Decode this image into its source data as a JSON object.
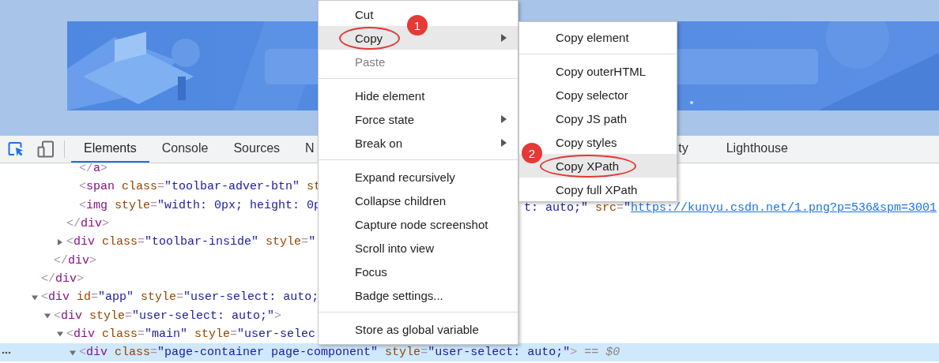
{
  "devtools": {
    "tabs": [
      {
        "label": "Elements",
        "kind": "tab",
        "selected": true
      },
      {
        "label": "Console",
        "kind": "tab",
        "selected": false
      },
      {
        "label": "Sources",
        "kind": "tab",
        "selected": false
      },
      {
        "label": "N",
        "kind": "clipped_end",
        "selected": false
      },
      {
        "label": "ty",
        "kind": "clipped_start",
        "selected": false
      },
      {
        "label": "Lighthouse",
        "kind": "tab",
        "selected": false
      }
    ],
    "dom_tree": [
      {
        "children": [
          {
            "children": [
              {
                "children": [
                  {
                    "selected": false,
                    "tokens": [
                      {
                        "kind": "punct",
                        "text": "</"
                      },
                      {
                        "kind": "tag",
                        "text": "a"
                      },
                      {
                        "kind": "punct",
                        "text": ">"
                      }
                    ]
                  },
                  {
                    "selected": false,
                    "tokens": [
                      {
                        "kind": "punct",
                        "text": "<"
                      },
                      {
                        "kind": "tag",
                        "text": "span"
                      },
                      {
                        "kind": "attr",
                        "text": " class"
                      },
                      {
                        "kind": "punct",
                        "text": "="
                      },
                      {
                        "kind": "value",
                        "text": "\"toolbar-adver-btn\""
                      },
                      {
                        "kind": "attr",
                        "text": " st"
                      }
                    ]
                  },
                  {
                    "selected": false,
                    "tokens": [
                      {
                        "kind": "punct",
                        "text": "<"
                      },
                      {
                        "kind": "tag",
                        "text": "img"
                      },
                      {
                        "kind": "attr",
                        "text": " style"
                      },
                      {
                        "kind": "punct",
                        "text": "="
                      },
                      {
                        "kind": "value",
                        "text": "\"width: 0px; height: 0p"
                      }
                    ],
                    "tail": {
                      "tokens": [
                        {
                          "kind": "value",
                          "text": "t: auto;\""
                        },
                        {
                          "kind": "attr",
                          "text": " src"
                        },
                        {
                          "kind": "punct",
                          "text": "="
                        },
                        {
                          "kind": "value",
                          "text": "\""
                        }
                      ],
                      "link": "https://kunyu.csdn.net/1.png?p=536&spm=3001"
                    }
                  }
                ]
              },
              {
                "selected": false,
                "tokens": [
                  {
                    "kind": "punct",
                    "text": "</"
                  },
                  {
                    "kind": "tag",
                    "text": "div"
                  },
                  {
                    "kind": "punct",
                    "text": ">"
                  }
                ]
              },
              {
                "selected": false,
                "expanded": false,
                "tokens": [
                  {
                    "kind": "punct",
                    "text": "<"
                  },
                  {
                    "kind": "tag",
                    "text": "div"
                  },
                  {
                    "kind": "attr",
                    "text": " class"
                  },
                  {
                    "kind": "punct",
                    "text": "="
                  },
                  {
                    "kind": "value",
                    "text": "\"toolbar-inside\""
                  },
                  {
                    "kind": "attr",
                    "text": " style"
                  },
                  {
                    "kind": "punct",
                    "text": "="
                  },
                  {
                    "kind": "value",
                    "text": "\""
                  }
                ]
              }
            ]
          },
          {
            "selected": false,
            "tokens": [
              {
                "kind": "punct",
                "text": "</"
              },
              {
                "kind": "tag",
                "text": "div"
              },
              {
                "kind": "punct",
                "text": ">"
              }
            ]
          }
        ]
      },
      {
        "selected": false,
        "tokens": [
          {
            "kind": "punct",
            "text": "</"
          },
          {
            "kind": "tag",
            "text": "div"
          },
          {
            "kind": "punct",
            "text": ">"
          }
        ]
      },
      {
        "selected": false,
        "expanded": true,
        "tokens": [
          {
            "kind": "punct",
            "text": "<"
          },
          {
            "kind": "tag",
            "text": "div"
          },
          {
            "kind": "attr",
            "text": " id"
          },
          {
            "kind": "punct",
            "text": "="
          },
          {
            "kind": "value",
            "text": "\"app\""
          },
          {
            "kind": "attr",
            "text": " style"
          },
          {
            "kind": "punct",
            "text": "="
          },
          {
            "kind": "value",
            "text": "\"user-select: auto;"
          }
        ],
        "children": [
          {
            "selected": false,
            "expanded": true,
            "tokens": [
              {
                "kind": "punct",
                "text": "<"
              },
              {
                "kind": "tag",
                "text": "div"
              },
              {
                "kind": "attr",
                "text": " style"
              },
              {
                "kind": "punct",
                "text": "="
              },
              {
                "kind": "value",
                "text": "\"user-select: auto;\""
              },
              {
                "kind": "punct",
                "text": ">"
              }
            ],
            "children": [
              {
                "selected": false,
                "expanded": true,
                "tokens": [
                  {
                    "kind": "punct",
                    "text": "<"
                  },
                  {
                    "kind": "tag",
                    "text": "div"
                  },
                  {
                    "kind": "attr",
                    "text": " class"
                  },
                  {
                    "kind": "punct",
                    "text": "="
                  },
                  {
                    "kind": "value",
                    "text": "\"main\""
                  },
                  {
                    "kind": "attr",
                    "text": " style"
                  },
                  {
                    "kind": "punct",
                    "text": "="
                  },
                  {
                    "kind": "value",
                    "text": "\"user-selec"
                  }
                ],
                "children": [
                  {
                    "selected": true,
                    "expanded": true,
                    "tokens": [
                      {
                        "kind": "punct",
                        "text": "<"
                      },
                      {
                        "kind": "tag",
                        "text": "div"
                      },
                      {
                        "kind": "attr",
                        "text": " class"
                      },
                      {
                        "kind": "punct",
                        "text": "="
                      },
                      {
                        "kind": "value",
                        "text": "\"page-container page-component\""
                      },
                      {
                        "kind": "attr",
                        "text": " style"
                      },
                      {
                        "kind": "punct",
                        "text": "="
                      },
                      {
                        "kind": "value",
                        "text": "\"user-select: auto;\""
                      },
                      {
                        "kind": "punct",
                        "text": ">"
                      },
                      {
                        "kind": "hint",
                        "text": " == $0"
                      }
                    ]
                  }
                ]
              }
            ]
          }
        ]
      }
    ]
  },
  "context_menu": {
    "groups": [
      {
        "items": [
          {
            "label": "Cut",
            "highlighted": false,
            "disabled": false,
            "submenu": false
          },
          {
            "label": "Copy",
            "highlighted": true,
            "disabled": false,
            "submenu": true,
            "marker": "1"
          },
          {
            "label": "Paste",
            "highlighted": false,
            "disabled": true,
            "submenu": false
          }
        ]
      },
      {
        "items": [
          {
            "label": "Hide element",
            "highlighted": false,
            "disabled": false,
            "submenu": false
          },
          {
            "label": "Force state",
            "highlighted": false,
            "disabled": false,
            "submenu": true
          },
          {
            "label": "Break on",
            "highlighted": false,
            "disabled": false,
            "submenu": true
          }
        ]
      },
      {
        "items": [
          {
            "label": "Expand recursively",
            "highlighted": false,
            "disabled": false,
            "submenu": false
          },
          {
            "label": "Collapse children",
            "highlighted": false,
            "disabled": false,
            "submenu": false
          },
          {
            "label": "Capture node screenshot",
            "highlighted": false,
            "disabled": false,
            "submenu": false
          },
          {
            "label": "Scroll into view",
            "highlighted": false,
            "disabled": false,
            "submenu": false
          },
          {
            "label": "Focus",
            "highlighted": false,
            "disabled": false,
            "submenu": false
          },
          {
            "label": "Badge settings...",
            "highlighted": false,
            "disabled": false,
            "submenu": false
          }
        ]
      },
      {
        "items": [
          {
            "label": "Store as global variable",
            "highlighted": false,
            "disabled": false,
            "submenu": false
          }
        ]
      }
    ]
  },
  "copy_submenu": {
    "groups": [
      {
        "items": [
          {
            "label": "Copy element",
            "highlighted": false,
            "disabled": false,
            "submenu": false
          }
        ]
      },
      {
        "items": [
          {
            "label": "Copy outerHTML",
            "highlighted": false,
            "disabled": false,
            "submenu": false
          },
          {
            "label": "Copy selector",
            "highlighted": false,
            "disabled": false,
            "submenu": false
          },
          {
            "label": "Copy JS path",
            "highlighted": false,
            "disabled": false,
            "submenu": false
          },
          {
            "label": "Copy styles",
            "highlighted": false,
            "disabled": false,
            "submenu": false
          },
          {
            "label": "Copy XPath",
            "highlighted": true,
            "disabled": false,
            "submenu": false,
            "marker": "2"
          },
          {
            "label": "Copy full XPath",
            "highlighted": false,
            "disabled": false,
            "submenu": false
          }
        ]
      }
    ]
  }
}
